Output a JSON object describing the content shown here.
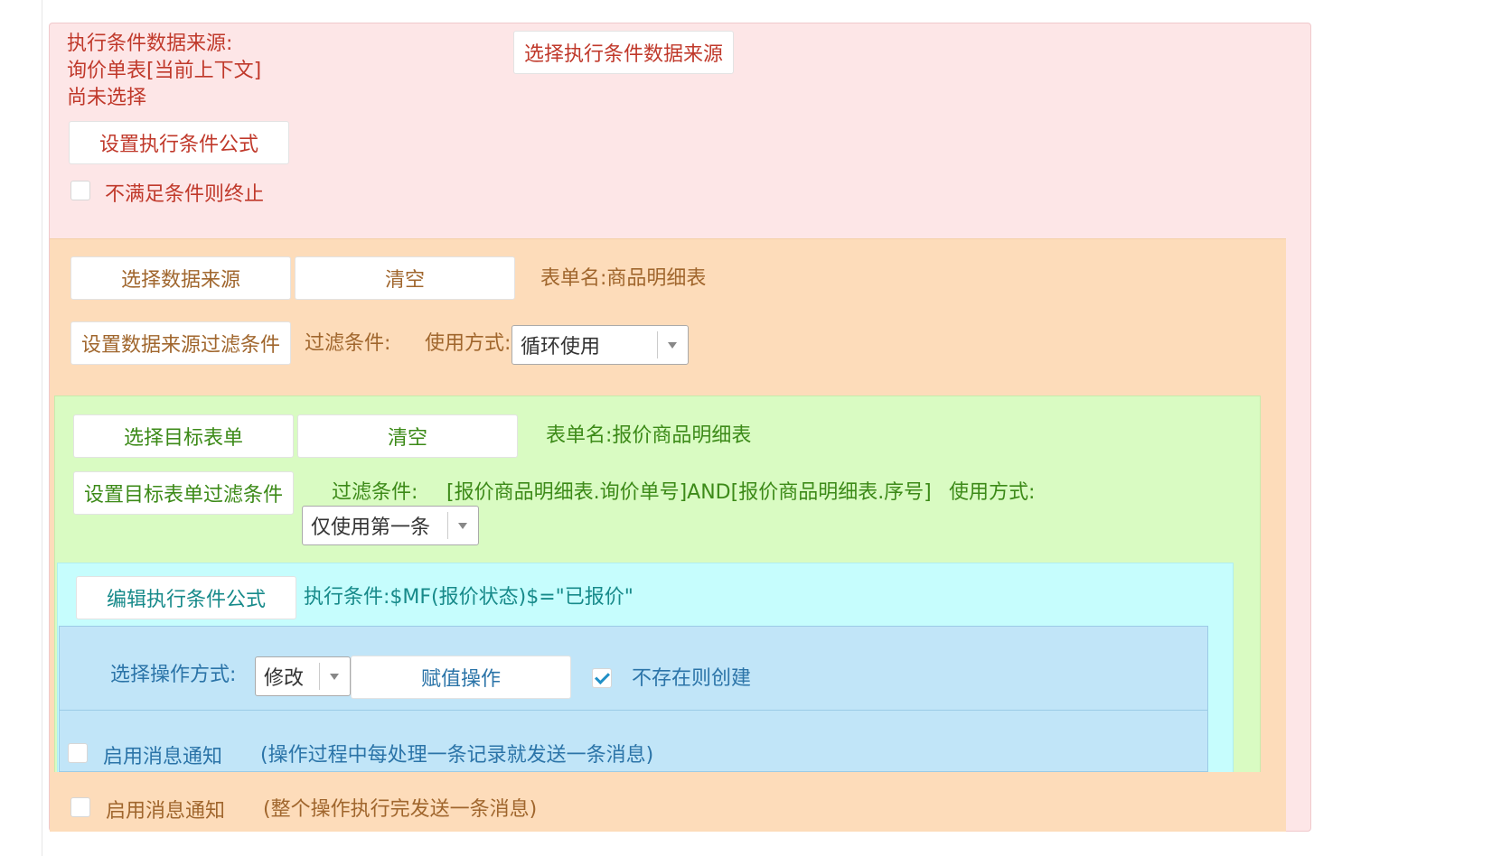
{
  "exec_condition": {
    "source_label": "执行条件数据来源:",
    "source_value": "询价单表[当前上下文]",
    "status": "尚未选择",
    "select_source_button": "选择执行条件数据来源",
    "set_formula_button": "设置执行条件公式",
    "terminate_checkbox_label": "不满足条件则终止",
    "terminate_checked": false
  },
  "data_source": {
    "select_button": "选择数据来源",
    "clear_button": "清空",
    "form_name": "表单名:商品明细表",
    "filter_button": "设置数据来源过滤条件",
    "filter_label": "过滤条件:",
    "usage_label": "使用方式:",
    "usage_value": "循环使用"
  },
  "target_form": {
    "select_button": "选择目标表单",
    "clear_button": "清空",
    "form_name": "表单名:报价商品明细表",
    "filter_button": "设置目标表单过滤条件",
    "filter_label": "过滤条件:",
    "filter_value": "[报价商品明细表.询价单号]AND[报价商品明细表.序号]",
    "usage_label": "使用方式:",
    "usage_value": "仅使用第一条"
  },
  "exec_formula": {
    "edit_button": "编辑执行条件公式",
    "condition_text": "执行条件:$MF(报价状态)$=\"已报价\""
  },
  "operation": {
    "mode_label": "选择操作方式:",
    "mode_value": "修改",
    "assign_button": "赋值操作",
    "create_checkbox_label": "不存在则创建",
    "create_checked": true
  },
  "notify_each": {
    "label": "启用消息通知",
    "hint": "(操作过程中每处理一条记录就发送一条消息)",
    "checked": false
  },
  "notify_all": {
    "label": "启用消息通知",
    "hint": "(整个操作执行完发送一条消息)",
    "checked": false
  },
  "colors": {
    "outer_bg": "#fde6e7",
    "datasrc_bg": "#fddcba",
    "target_bg": "#d9fbc2",
    "exec_bg": "#c6fdfd",
    "op_bg": "#c1e5f8"
  }
}
